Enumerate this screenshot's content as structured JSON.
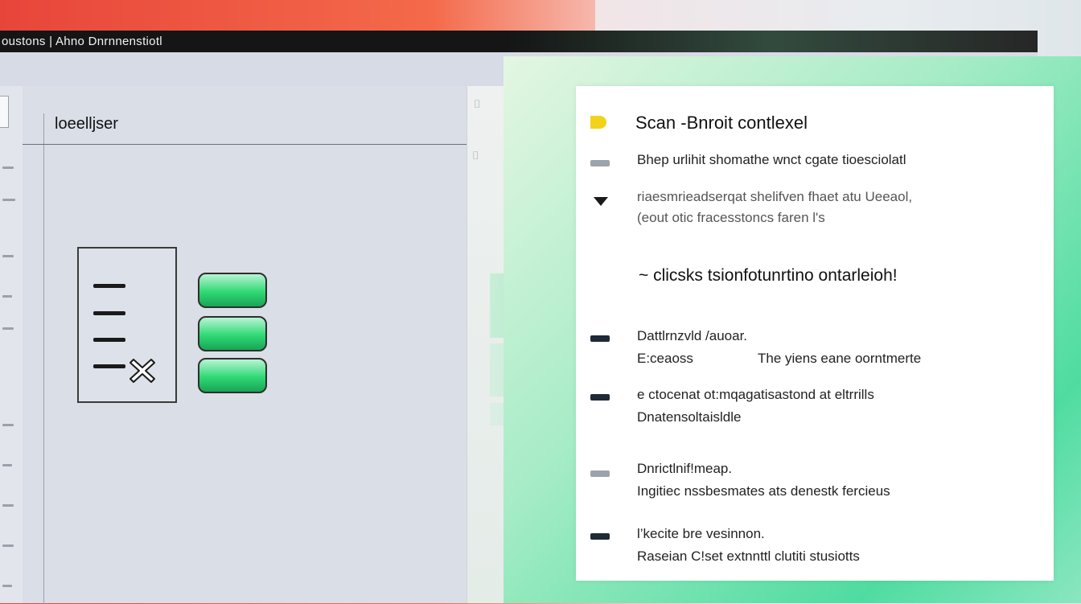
{
  "window": {
    "title": "oustons | Ahno  Dnrnnenstiotl"
  },
  "left_panel": {
    "title": "loeelljser"
  },
  "middle_panel": {
    "label": "lhsv"
  },
  "card": {
    "title": "Scan -Bnroit contlexel",
    "line1": "Bhep urlihit shomathe wnct cgate  tioesciolatl",
    "line2a": "riaesmrieadserqat shelifven fhaet atu Ueeaol,",
    "line2b": "(eout otic fracesstoncs faren  l's",
    "highlight": "~ clicsks tsionfotunrtino ontarleioh!",
    "item1_title": "Dattlrnzvld /auoar.",
    "item1_sub_a": "E:ceaoss",
    "item1_sub_b": "The yiens eane oorntmerte",
    "item2_title": "e ctocenat ot:mqagatisastond at eltrrills",
    "item2_sub": "Dnatensoltaisldle",
    "item3_title": "Dnrictlnif!meap.",
    "item3_sub": "Ingitiec nssbesmates ats denestk fercieus",
    "item4_title": "l’kecite bre vesinnon.",
    "item4_sub": "Raseian C!set extnnttl clutiti stusiotts"
  },
  "colors": {
    "accent_green": "#2fd974",
    "title_bar": "#151515",
    "bullet_yellow": "#f2d31b"
  },
  "icons": [
    "document-icon",
    "remove-x-icon",
    "database-icon"
  ]
}
